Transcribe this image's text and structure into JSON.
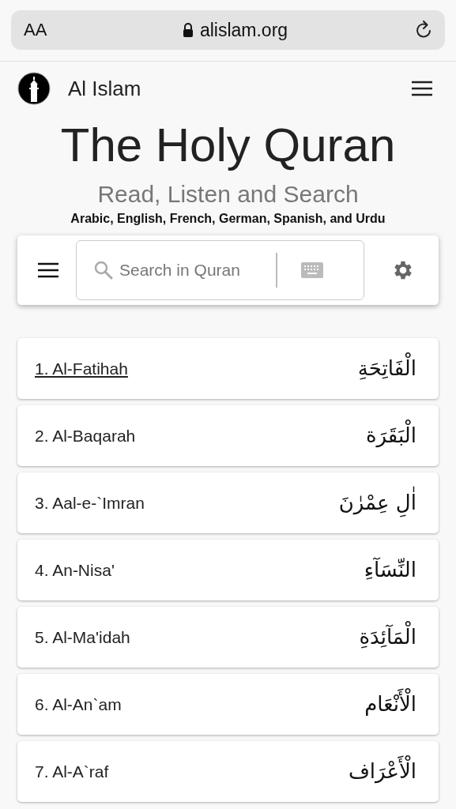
{
  "browser_bar": {
    "text_size_button": "AA",
    "url": "alislam.org"
  },
  "header": {
    "site_name": "Al Islam"
  },
  "hero": {
    "title": "The Holy Quran",
    "subtitle": "Read, Listen and Search",
    "languages": "Arabic, English, French, German, Spanish, and Urdu"
  },
  "search": {
    "placeholder": "Search in Quran"
  },
  "chapters": [
    {
      "name": "1. Al-Fatihah",
      "arabic": "الْفَاتِحَةِ",
      "selected": true
    },
    {
      "name": "2. Al-Baqarah",
      "arabic": "الْبَقَرَة",
      "selected": false
    },
    {
      "name": "3. Aal-e-`Imran",
      "arabic": "اٰلِ عِمْرٰنَ",
      "selected": false
    },
    {
      "name": "4. An-Nisa'",
      "arabic": "النِّسَآءِ",
      "selected": false
    },
    {
      "name": "5. Al-Ma'idah",
      "arabic": "الْمَآئِدَةِ",
      "selected": false
    },
    {
      "name": "6. Al-An`am",
      "arabic": "الْأَنْعَام",
      "selected": false
    },
    {
      "name": "7. Al-A`raf",
      "arabic": "الْأَعْرَاف",
      "selected": false
    }
  ]
}
